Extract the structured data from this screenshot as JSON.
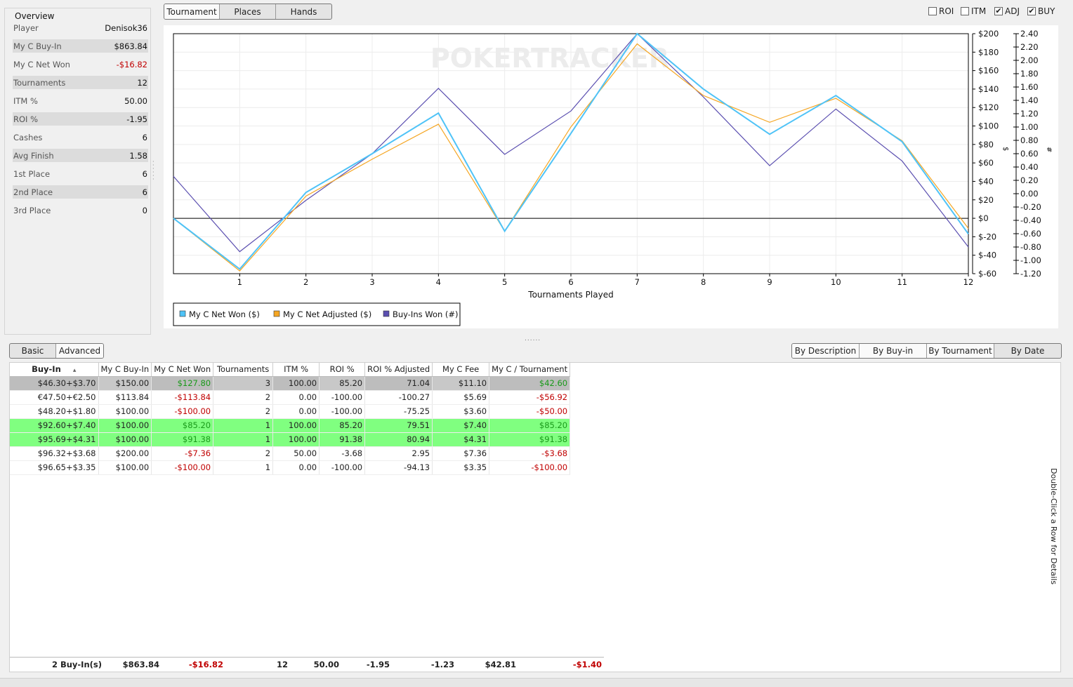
{
  "overview": {
    "title": "Overview",
    "rows": [
      {
        "label": "Player",
        "value": "Denisok36",
        "neg": false
      },
      {
        "label": "My C Buy-In",
        "value": "$863.84",
        "neg": false
      },
      {
        "label": "My C Net Won",
        "value": "-$16.82",
        "neg": true
      },
      {
        "label": "Tournaments",
        "value": "12",
        "neg": false
      },
      {
        "label": "ITM %",
        "value": "50.00",
        "neg": false
      },
      {
        "label": "ROI %",
        "value": "-1.95",
        "neg": false
      },
      {
        "label": "Cashes",
        "value": "6",
        "neg": false
      },
      {
        "label": "Avg Finish",
        "value": "1.58",
        "neg": false
      },
      {
        "label": "1st Place",
        "value": "6",
        "neg": false
      },
      {
        "label": "2nd Place",
        "value": "6",
        "neg": false
      },
      {
        "label": "3rd Place",
        "value": "0",
        "neg": false
      }
    ]
  },
  "top_tabs": [
    "Tournament",
    "Places",
    "Hands"
  ],
  "top_tab_active": "Tournament",
  "checkboxes": [
    {
      "label": "ROI",
      "checked": false
    },
    {
      "label": "ITM",
      "checked": false
    },
    {
      "label": "ADJ",
      "checked": true
    },
    {
      "label": "BUY",
      "checked": true
    }
  ],
  "chart_data": {
    "type": "line",
    "watermark": "POKERTRACKER",
    "xlabel": "Tournaments Played",
    "x": [
      0,
      1,
      2,
      3,
      4,
      5,
      6,
      7,
      8,
      9,
      10,
      11,
      12
    ],
    "xticks": [
      1,
      2,
      3,
      4,
      5,
      6,
      7,
      8,
      9,
      10,
      11,
      12
    ],
    "ylim": [
      -60,
      200
    ],
    "yticks": [
      -60,
      -40,
      -20,
      0,
      20,
      40,
      60,
      80,
      100,
      120,
      140,
      160,
      180,
      200
    ],
    "ylabel": "$",
    "y2lim": [
      -1.2,
      2.4
    ],
    "y2ticks": [
      "-1.20",
      "-1.00",
      "-0.80",
      "-0.60",
      "-0.40",
      "-0.20",
      "0.00",
      "0.20",
      "0.40",
      "0.60",
      "0.80",
      "1.00",
      "1.20",
      "1.40",
      "1.60",
      "1.80",
      "2.00",
      "2.20",
      "2.40"
    ],
    "y2label": "#",
    "grid": true,
    "legend_position": "bottom-left",
    "series": [
      {
        "name": "My C Net Won ($)",
        "color": "#4fc3f7",
        "axis": "left",
        "values": [
          0,
          -55,
          28,
          70,
          114,
          -14,
          92,
          200,
          140,
          91,
          133,
          83,
          -17
        ]
      },
      {
        "name": "My C Net Adjusted ($)",
        "color": "#f5a623",
        "axis": "left",
        "values": [
          0,
          -57,
          24,
          64,
          102,
          -14,
          99,
          189,
          133,
          104,
          130,
          84,
          -11
        ]
      },
      {
        "name": "Buy-Ins Won (#)",
        "color": "#5b4fb0",
        "axis": "right",
        "values": [
          0.26,
          -0.87,
          -0.1,
          0.6,
          1.58,
          0.59,
          1.24,
          2.4,
          1.45,
          0.42,
          1.27,
          0.49,
          -0.8
        ]
      }
    ]
  },
  "detail_tabs": [
    "Basic",
    "Advanced"
  ],
  "group_tabs": [
    "By Description",
    "By Buy-in",
    "By Tournament",
    "By Date"
  ],
  "table": {
    "columns": [
      "Buy-In",
      "My C Buy-In",
      "My C Net Won",
      "Tournaments",
      "ITM %",
      "ROI %",
      "ROI % Adjusted",
      "My C Fee",
      "My C / Tournament"
    ],
    "rows": [
      {
        "style": "sel",
        "cells": [
          "$46.30+$3.70",
          "$150.00",
          "$127.80",
          "3",
          "100.00",
          "85.20",
          "71.04",
          "$11.10",
          "$42.60"
        ],
        "signs": [
          "",
          "",
          "pos",
          "",
          "",
          "",
          "",
          "",
          "pos"
        ]
      },
      {
        "style": "",
        "cells": [
          "€47.50+€2.50",
          "$113.84",
          "-$113.84",
          "2",
          "0.00",
          "-100.00",
          "-100.27",
          "$5.69",
          "-$56.92"
        ],
        "signs": [
          "",
          "",
          "neg",
          "",
          "",
          "",
          "",
          "",
          "neg"
        ]
      },
      {
        "style": "",
        "cells": [
          "$48.20+$1.80",
          "$100.00",
          "-$100.00",
          "2",
          "0.00",
          "-100.00",
          "-75.25",
          "$3.60",
          "-$50.00"
        ],
        "signs": [
          "",
          "",
          "neg",
          "",
          "",
          "",
          "",
          "",
          "neg"
        ]
      },
      {
        "style": "hl",
        "cells": [
          "$92.60+$7.40",
          "$100.00",
          "$85.20",
          "1",
          "100.00",
          "85.20",
          "79.51",
          "$7.40",
          "$85.20"
        ],
        "signs": [
          "",
          "",
          "pos",
          "",
          "",
          "",
          "",
          "",
          "pos"
        ]
      },
      {
        "style": "hl",
        "cells": [
          "$95.69+$4.31",
          "$100.00",
          "$91.38",
          "1",
          "100.00",
          "91.38",
          "80.94",
          "$4.31",
          "$91.38"
        ],
        "signs": [
          "",
          "",
          "pos",
          "",
          "",
          "",
          "",
          "",
          "pos"
        ]
      },
      {
        "style": "",
        "cells": [
          "$96.32+$3.68",
          "$200.00",
          "-$7.36",
          "2",
          "50.00",
          "-3.68",
          "2.95",
          "$7.36",
          "-$3.68"
        ],
        "signs": [
          "",
          "",
          "neg",
          "",
          "",
          "",
          "",
          "",
          "neg"
        ]
      },
      {
        "style": "",
        "cells": [
          "$96.65+$3.35",
          "$100.00",
          "-$100.00",
          "1",
          "0.00",
          "-100.00",
          "-94.13",
          "$3.35",
          "-$100.00"
        ],
        "signs": [
          "",
          "",
          "neg",
          "",
          "",
          "",
          "",
          "",
          "neg"
        ]
      }
    ],
    "footer": [
      "2 Buy-In(s)",
      "$863.84",
      "-$16.82",
      "12",
      "50.00",
      "-1.95",
      "-1.23",
      "$42.81",
      "-$1.40"
    ],
    "footer_signs": [
      "",
      "",
      "neg",
      "",
      "",
      "",
      "",
      "",
      "neg"
    ]
  },
  "side_note": "Double-Click a Row for Details"
}
